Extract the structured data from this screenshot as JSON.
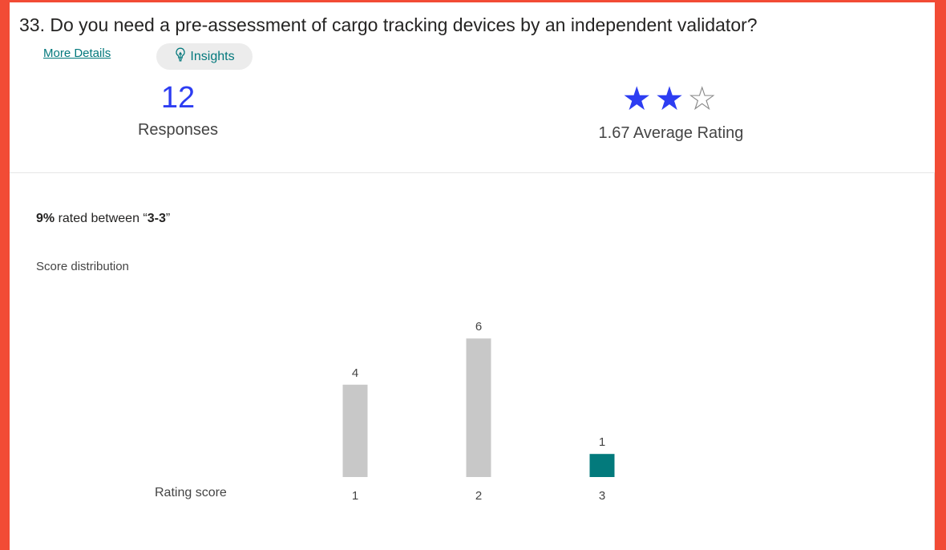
{
  "question": {
    "title": "33.  Do you need a pre-assessment of cargo tracking devices by an independent validator?"
  },
  "links": {
    "more_details": "More Details",
    "insights": "Insights"
  },
  "stats": {
    "responses_count": "12",
    "responses_label": "Responses",
    "average_rating_label": "1.67 Average Rating",
    "stars_filled": 2,
    "stars_total": 3
  },
  "summary": {
    "percent": "9%",
    "middle": " rated between “",
    "range": "3-3",
    "end": "”"
  },
  "distribution_title": "Score distribution",
  "chart_data": {
    "type": "bar",
    "xlabel": "Rating score",
    "categories": [
      "1",
      "2",
      "3"
    ],
    "values": [
      4,
      6,
      1
    ],
    "highlight_index": 2,
    "colors": {
      "default": "#c8c8c8",
      "highlight": "#037a7c"
    }
  },
  "colors": {
    "accent": "#2d3df2",
    "teal": "#03787c",
    "frame": "#f24b35"
  }
}
